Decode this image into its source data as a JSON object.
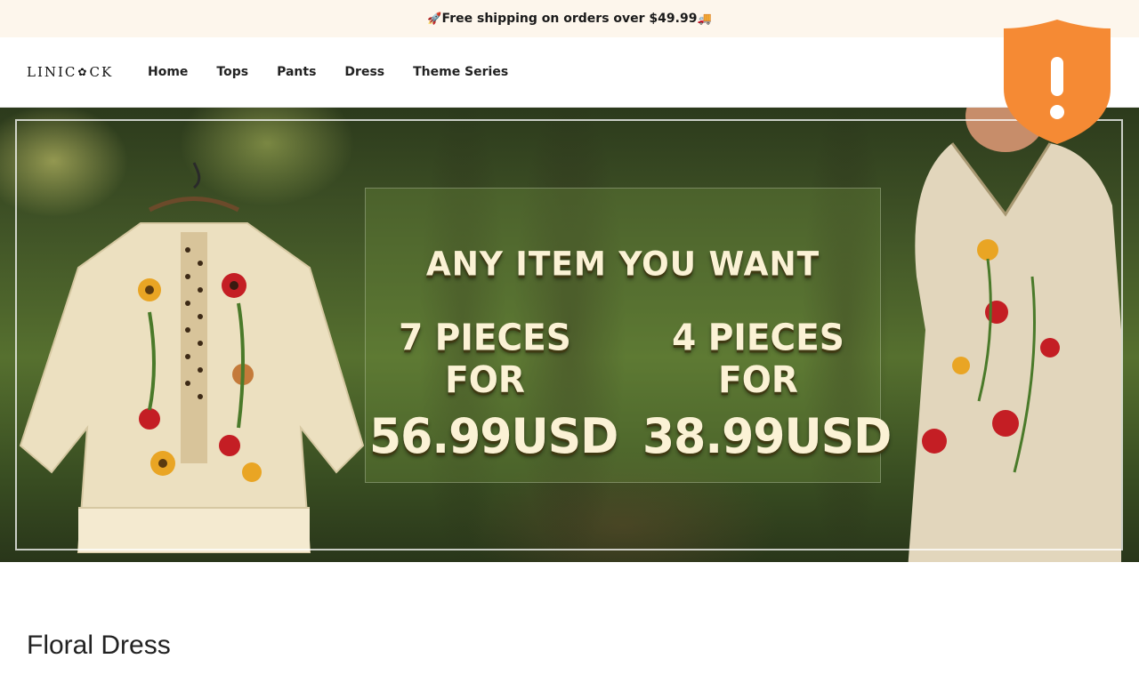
{
  "announcement": {
    "rocket_icon": "rocket-icon",
    "text": "Free shipping on orders over $49.99",
    "truck_icon": "delivery-truck-icon"
  },
  "header": {
    "logo_left": "LINIC",
    "logo_mark": "✿",
    "logo_right": "CK",
    "nav": [
      {
        "label": "Home"
      },
      {
        "label": "Tops"
      },
      {
        "label": "Pants"
      },
      {
        "label": "Dress"
      },
      {
        "label": "Theme Series"
      }
    ]
  },
  "security_badge": {
    "icon": "warning-shield-icon",
    "color": "#f58a34",
    "symbol": "!"
  },
  "hero": {
    "headline": "ANY ITEM YOU WANT",
    "offers": [
      {
        "pieces": "7 PIECES FOR",
        "price": "56.99USD"
      },
      {
        "pieces": "4 PIECES FOR",
        "price": "38.99USD"
      }
    ]
  },
  "section": {
    "title": "Floral Dress"
  }
}
